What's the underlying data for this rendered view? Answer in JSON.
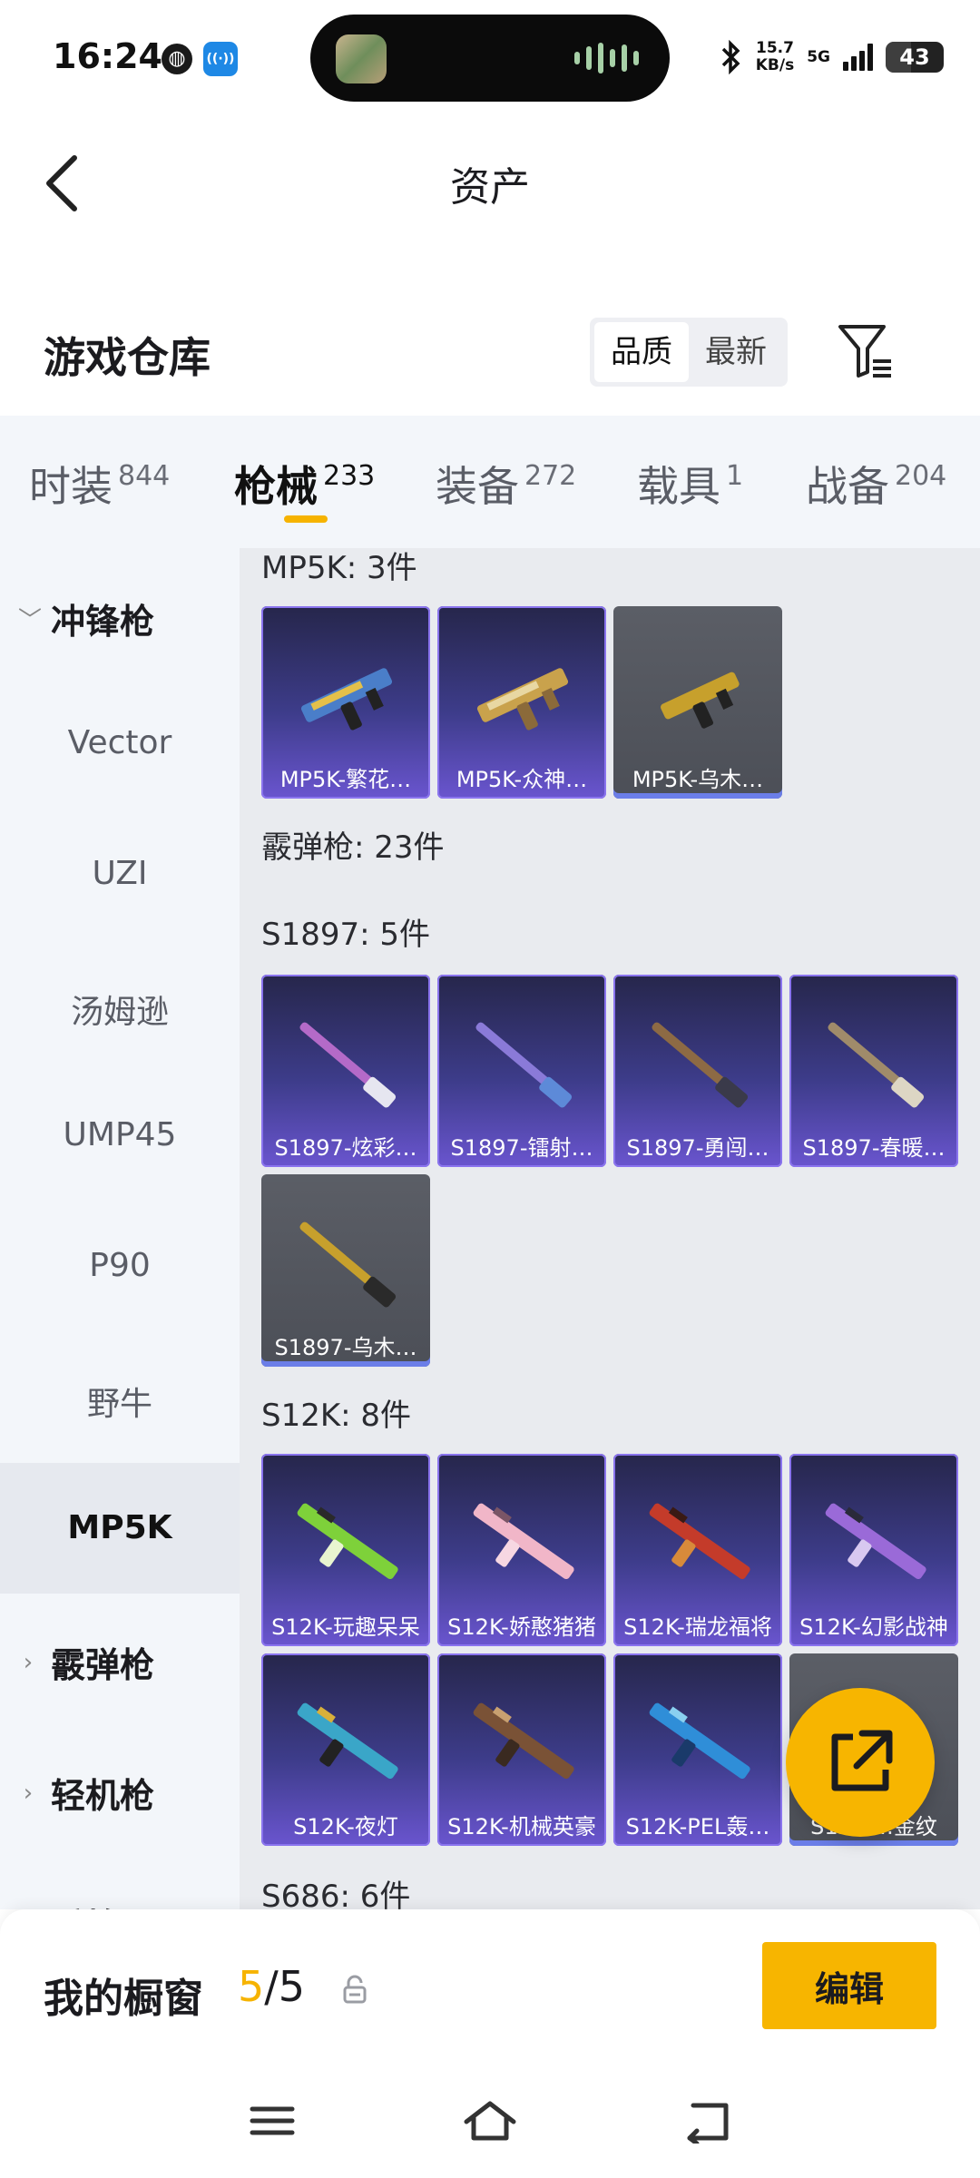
{
  "status_bar": {
    "time": "16:24",
    "net_speed_value": "15.7",
    "net_speed_unit": "KB/s",
    "network": "5G",
    "battery": "43",
    "icons": [
      "globe-icon",
      "app-notification-icon",
      "bluetooth-icon",
      "signal-icon",
      "battery-icon"
    ]
  },
  "header": {
    "title": "资产",
    "back_icon": "chevron-left-icon"
  },
  "repository": {
    "title": "游戏仓库",
    "sort_options": [
      "品质",
      "最新"
    ],
    "sort_selected": "品质",
    "filter_icon": "filter-icon"
  },
  "tabs": [
    {
      "label": "时装",
      "count": "844"
    },
    {
      "label": "枪械",
      "count": "233",
      "active": true
    },
    {
      "label": "装备",
      "count": "272"
    },
    {
      "label": "载具",
      "count": "1"
    },
    {
      "label": "战备",
      "count": "204"
    }
  ],
  "sidebar": {
    "categories": [
      "冲锋枪",
      "霰弹枪",
      "轻机枪",
      "手枪"
    ],
    "sub_items": [
      "Vector",
      "UZI",
      "汤姆逊",
      "UMP45",
      "P90",
      "野牛",
      "MP5K"
    ],
    "active_sub": "MP5K"
  },
  "sections": {
    "mp5k": {
      "title": "MP5K: 3件",
      "items": [
        "MP5K-繁花…",
        "MP5K-众神…",
        "MP5K-乌木…"
      ]
    },
    "shotgun": {
      "title": "霰弹枪: 23件"
    },
    "s1897": {
      "title": "S1897: 5件",
      "items": [
        "S1897-炫彩…",
        "S1897-镭射…",
        "S1897-勇闯…",
        "S1897-春暖…",
        "S1897-乌木…"
      ]
    },
    "s12k": {
      "title": "S12K: 8件",
      "items": [
        "S12K-玩趣呆呆",
        "S12K-娇憨猪猪",
        "S12K-瑞龙福将",
        "S12K-幻影战神",
        "S12K-夜灯",
        "S12K-机械英豪",
        "S12K-PEL轰…",
        "S12K-…金纹"
      ]
    },
    "s686": {
      "title": "S686: 6件"
    }
  },
  "fab": {
    "icon": "share-external-icon"
  },
  "showcase": {
    "label": "我的橱窗",
    "current": "5",
    "total": "/5",
    "lock_icon": "lock-icon",
    "edit_label": "编辑"
  },
  "nav": {
    "icons": [
      "menu-icon",
      "home-icon",
      "back-icon"
    ]
  },
  "colors": {
    "accent": "#f7b500",
    "tab_underline": "#f6b300",
    "card_purple": "#3d3c8a",
    "card_gray": "#4c4f57"
  }
}
